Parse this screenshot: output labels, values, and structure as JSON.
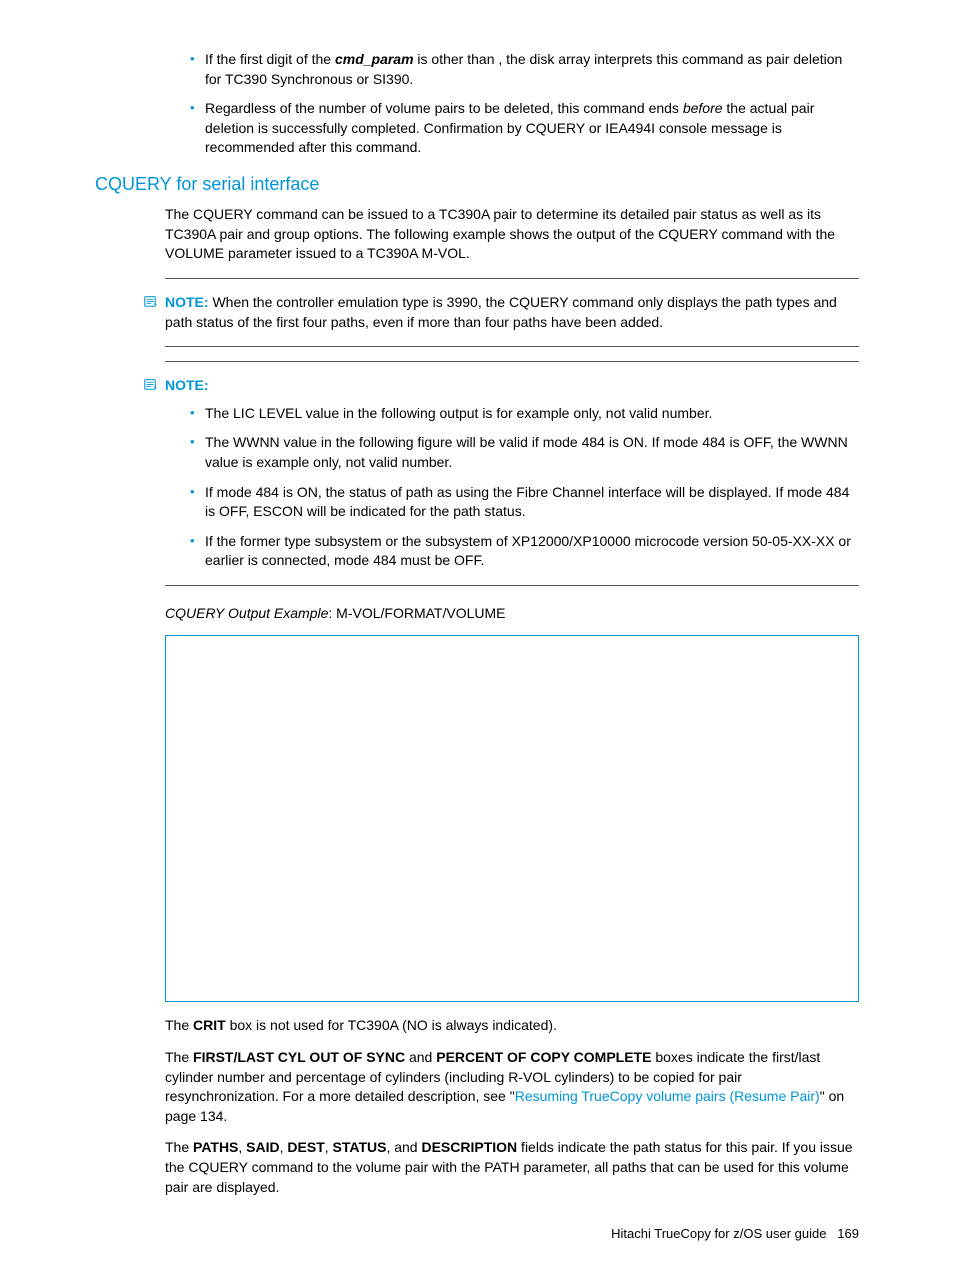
{
  "bullets_top": [
    {
      "pre": "If the first digit of the ",
      "cmd": "cmd_param",
      "post": " is other than   , the disk array interprets this command as pair deletion for TC390 Synchronous or SI390."
    },
    {
      "text_a": "Regardless of the number of volume pairs to be deleted, this command ends ",
      "italic": "before",
      "text_b": " the actual pair deletion is successfully completed. Confirmation by CQUERY or IEA494I console message is recommended after this command."
    }
  ],
  "section_heading": "CQUERY for serial interface",
  "intro_para": "The CQUERY command can be issued to a TC390A pair to determine its detailed pair status as well as its TC390A pair and group options. The following example shows the output of the CQUERY command with the VOLUME parameter issued to a TC390A M-VOL.",
  "note1": {
    "label": "NOTE:",
    "text": "   When the controller emulation type is 3990, the CQUERY command only displays the path types and path status of the first four paths, even if more than four paths have been added."
  },
  "note2": {
    "label": "NOTE:",
    "items": [
      "The LIC LEVEL value in the following output is for example only, not valid number.",
      "The WWNN value in the following figure will be valid if mode 484 is ON. If mode 484 is OFF, the WWNN value is example only, not valid number.",
      "If mode 484 is ON, the status of path as using the Fibre Channel interface will be displayed. If mode 484 is OFF, ESCON will be indicated for the path status.",
      "If the former type subsystem or the subsystem of XP12000/XP10000 microcode version 50-05-XX-XX or earlier is connected, mode 484 must be OFF."
    ]
  },
  "output_caption": {
    "italic": "CQUERY Output Example",
    "rest": ": M-VOL/FORMAT/VOLUME"
  },
  "crit_para": {
    "pre": "The ",
    "b1": "CRIT",
    "post": " box is not used for TC390A (NO is always indicated)."
  },
  "firstlast_para": {
    "pre": "The ",
    "b1": "FIRST/LAST CYL OUT OF SYNC",
    "mid1": " and ",
    "b2": "PERCENT OF COPY COMPLETE",
    "post1": " boxes indicate the first/last cylinder number and percentage of cylinders (including R-VOL cylinders) to be copied for pair resynchronization. For a more detailed description, see \"",
    "link": "Resuming TrueCopy volume pairs (Resume Pair)",
    "post2": "\" on page 134."
  },
  "paths_para": {
    "pre": "The ",
    "b1": "PATHS",
    "c1": ", ",
    "b2": "SAID",
    "c2": ", ",
    "b3": "DEST",
    "c3": ", ",
    "b4": "STATUS",
    "c4": ", and ",
    "b5": "DESCRIPTION",
    "post": " fields indicate the path status for this pair. If you issue the CQUERY command to the volume pair with the PATH parameter, all paths that can be used for this volume pair are displayed."
  },
  "footer": {
    "title": "Hitachi TrueCopy for z/OS user guide",
    "page": "169"
  }
}
